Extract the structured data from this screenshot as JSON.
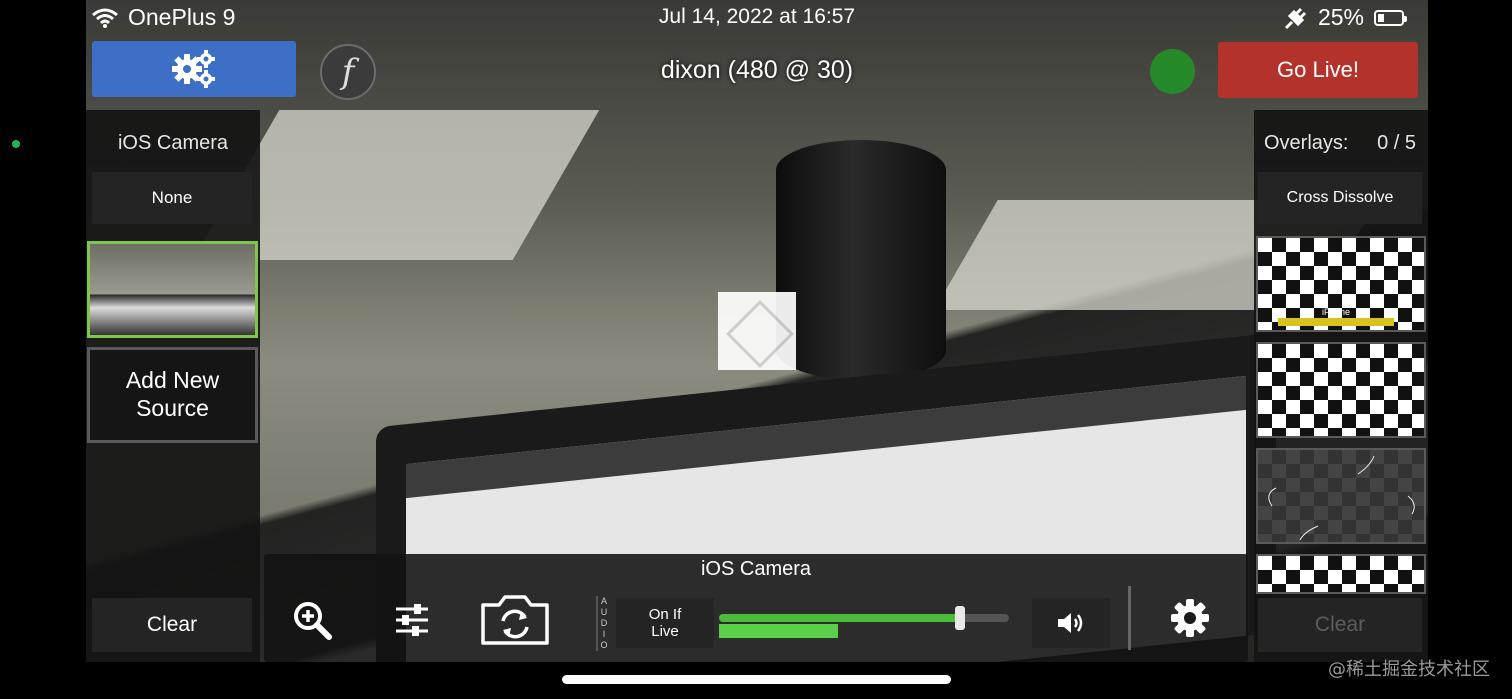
{
  "status_bar": {
    "carrier": "OnePlus 9",
    "datetime": "Jul 14, 2022 at 16:57",
    "battery_percent": "25%",
    "icons": [
      "wifi-icon",
      "charging-plug-icon",
      "battery-icon"
    ]
  },
  "top_bar": {
    "settings_icon": "gears-icon",
    "flash_glyph": "f",
    "stream_title": "dixon  (480 @ 30)",
    "status_color": "#26892a",
    "go_live_label": "Go Live!"
  },
  "left_panel": {
    "title": "iOS Camera",
    "none_label": "None",
    "add_source_label": "Add New Source",
    "clear_label": "Clear",
    "selected_border_color": "#7ec74a"
  },
  "right_panel": {
    "overlays_label": "Overlays:",
    "overlays_count": "0  /  5",
    "transition_label": "Cross Dissolve",
    "clear_label": "Clear",
    "overlay_1_text": "iPhone"
  },
  "controls": {
    "source_title": "iOS Camera",
    "audio_label": "AUDIO",
    "audio_mode": "On If Live",
    "volume_level": 0.83,
    "meter_level": 0.41,
    "icons": [
      "zoom-in-icon",
      "sliders-icon",
      "camera-switch-icon",
      "speaker-icon",
      "gear-icon"
    ]
  },
  "watermark": "@稀土掘金技术社区",
  "colors": {
    "settings_button": "#3d6fc6",
    "go_live_button": "#b3322c",
    "audio_green": "#4cbc3c"
  }
}
